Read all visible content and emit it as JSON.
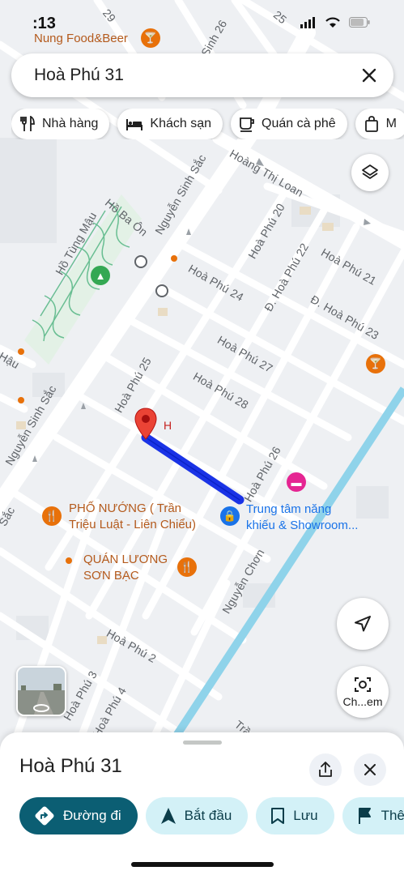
{
  "status": {
    "time": ":13"
  },
  "search": {
    "query": "Hoà Phú 31"
  },
  "chips": [
    {
      "label": "Nhà hàng",
      "icon": "fork-knife-icon"
    },
    {
      "label": "Khách sạn",
      "icon": "bed-icon"
    },
    {
      "label": "Quán cà phê",
      "icon": "coffee-cup-icon"
    },
    {
      "label": "M",
      "icon": "shopping-bag-icon"
    }
  ],
  "map": {
    "streets": {
      "hoang_thi_loan": "Hoàng Thị Loan",
      "nguyen_sinh_sac_upper": "Nguyễn Sinh Sắc",
      "nguyen_sinh_sac_lower": "Nguyễn Sinh Sắc",
      "sac": "Sắc",
      "hoa_phu_20": "Hoà Phú 20",
      "hoa_phu_21": "Hoà Phú 21",
      "hoa_phu_22": "Đ. Hoà Phú 22",
      "hoa_phu_23": "Đ. Hoà Phú 23",
      "hoa_phu_24": "Hoà Phú 24",
      "hoa_phu_25": "Hoà Phú 25",
      "hoa_phu_26": "Hoà Phú 26",
      "hoa_phu_27": "Hoà Phú 27",
      "hoa_phu_28": "Hoà Phú 28",
      "hoa_phu_2": "Hoà Phú 2",
      "hoa_phu_3": "Hoà Phú 3",
      "hoa_phu_4": "Hoà Phú 4",
      "nguyen_chon": "Nguyễn Chơn",
      "sinh_26": "Sinh 26",
      "hau": "Hậu",
      "tra": "Trầ",
      "num_29": "29",
      "num_25": "25"
    },
    "lakes": {
      "ho_ba_on": "Hồ Ba Ôn",
      "ho_tung_mau": "Hồ Tùng Mậu"
    },
    "pois": {
      "nung_food": "Nung Food&Beer",
      "pho_nuong_line1": "PHỐ NƯỚNG ( Trần",
      "pho_nuong_line2": "Triệu Luật - Liên Chiểu)",
      "quan_luong_line1": "QUÁN LƯƠNG",
      "quan_luong_line2": "SƠN BẠC",
      "trung_tam_line1": "Trung tâm năng",
      "trung_tam_line2": "khiếu & Showroom...",
      "pin_label": "H"
    },
    "colors": {
      "route": "#1a33e6",
      "pin": "#ea4335",
      "canal": "#8fd3ea",
      "road": "#ffffff",
      "bg": "#eef0f3"
    }
  },
  "controls": {
    "lens_label": "Ch...em"
  },
  "sheet": {
    "title": "Hoà Phú 31",
    "actions": [
      {
        "label": "Đường đi",
        "icon": "directions-icon",
        "primary": true
      },
      {
        "label": "Bắt đầu",
        "icon": "navigation-arrow-icon",
        "primary": false
      },
      {
        "label": "Lưu",
        "icon": "bookmark-icon",
        "primary": false
      },
      {
        "label": "Thê",
        "icon": "flag-icon",
        "primary": false
      }
    ]
  }
}
